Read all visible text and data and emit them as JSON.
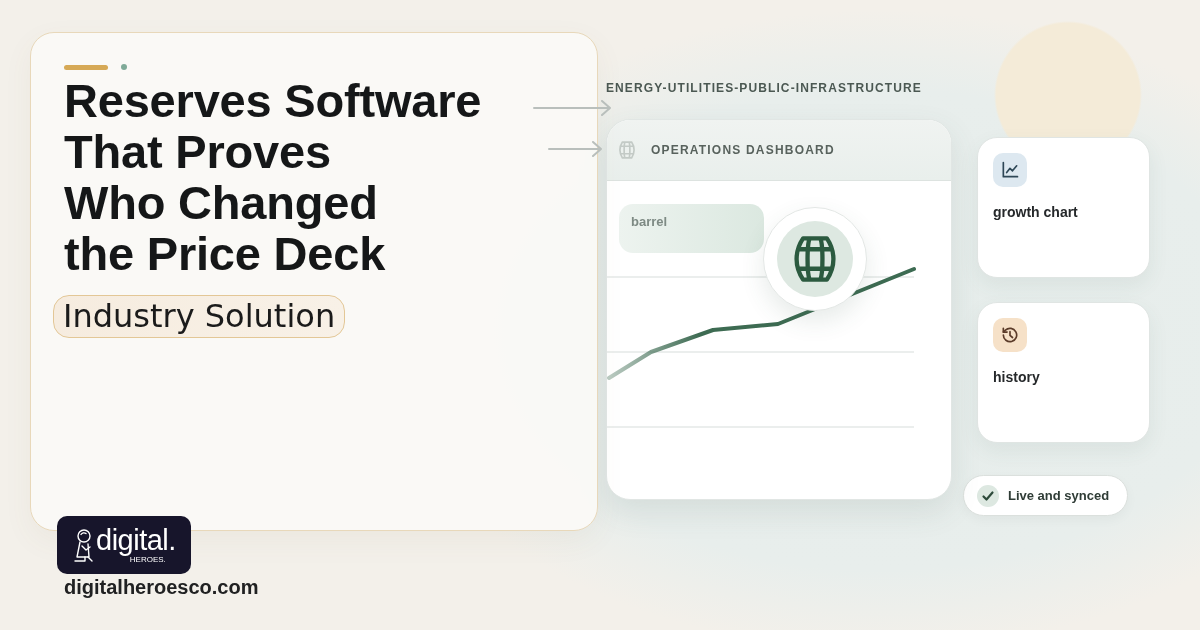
{
  "hero": {
    "title": "Reserves Software\nThat Proves\nWho Changed\nthe Price Deck",
    "tag": "Industry Solution"
  },
  "brand": {
    "logo_text": "digital.",
    "logo_subtext": "HEROES.",
    "website": "digitalheroesco.com"
  },
  "breadcrumb": "ENERGY-UTILITIES-PUBLIC-INFRASTRUCTURE",
  "dashboard": {
    "title": "OPERATIONS DASHBOARD",
    "label": "barrel"
  },
  "feature_cards": [
    {
      "label": "growth chart",
      "kind": "chart"
    },
    {
      "label": "history",
      "kind": "history"
    }
  ],
  "status_badge": {
    "label": "Live and synced"
  }
}
